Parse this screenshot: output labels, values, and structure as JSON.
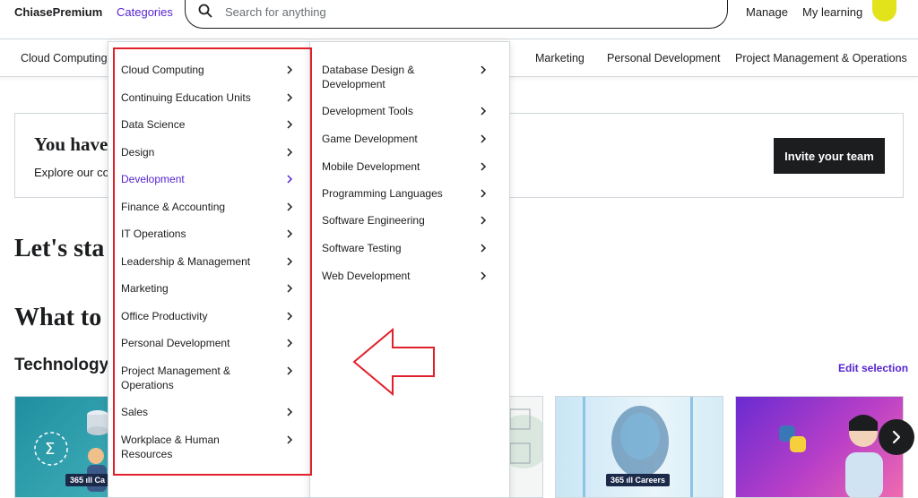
{
  "header": {
    "logo": "ChiasePremium",
    "categories": "Categories",
    "search_placeholder": "Search for anything",
    "manage": "Manage",
    "my_learning": "My learning"
  },
  "subnav": [
    "Cloud Computing",
    "Marketing",
    "Personal Development",
    "Project Management & Operations"
  ],
  "banner": {
    "title": "You have",
    "text": "Explore our co",
    "invite_button": "Invite your team"
  },
  "sections": {
    "lets_start": "Let's sta",
    "what_to": "What to",
    "technology": "Technology",
    "edit_selection": "Edit selection"
  },
  "cards": {
    "badge_1": "365 ıll Ca",
    "badge_4": "365 ıll Careers"
  },
  "menu": {
    "categories": [
      "Cloud Computing",
      "Continuing Education Units",
      "Data Science",
      "Design",
      "Development",
      "Finance & Accounting",
      "IT Operations",
      "Leadership & Management",
      "Marketing",
      "Office Productivity",
      "Personal Development",
      "Project Management & Operations",
      "Sales",
      "Workplace & Human Resources"
    ],
    "active": "Development",
    "subcategories": [
      "Database Design & Development",
      "Development Tools",
      "Game Development",
      "Mobile Development",
      "Programming Languages",
      "Software Engineering",
      "Software Testing",
      "Web Development"
    ]
  },
  "colors": {
    "accent": "#5624d0",
    "annotation": "#e0202a",
    "dark": "#1c1d1f"
  }
}
